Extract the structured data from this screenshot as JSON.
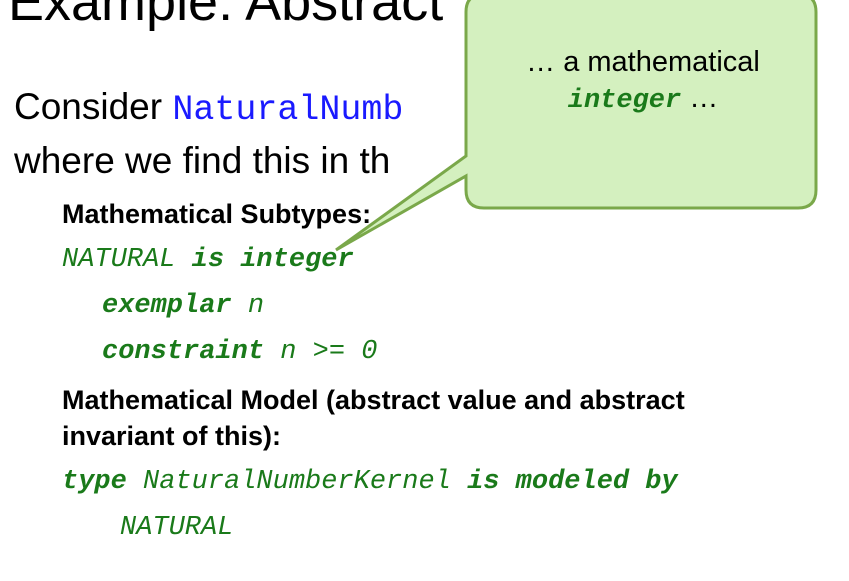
{
  "slide": {
    "title": "Example: Abstract",
    "intro_prefix": "Consider ",
    "intro_code": "NaturalNumb",
    "line2": "where we find this in th"
  },
  "subtypes": {
    "heading": "Mathematical Subtypes:",
    "line1": {
      "name": "NATURAL",
      "kw": "is integer"
    },
    "line2": {
      "kw": "exemplar",
      "var": "n"
    },
    "line3": {
      "kw": "constraint",
      "expr": "n >= 0"
    }
  },
  "model": {
    "heading_line1": "Mathematical Model (abstract value and abstract",
    "heading_line2": "invariant of this):",
    "code_line1": {
      "kw1": "type",
      "name": "NaturalNumberKernel",
      "kw2": "is modeled by"
    },
    "code_line2": "NATURAL"
  },
  "callout": {
    "prefix": "… a mathematical",
    "code": "integer",
    "suffix": " …",
    "fill_color": "#d4f0bf",
    "stroke_color": "#7aa84a"
  }
}
